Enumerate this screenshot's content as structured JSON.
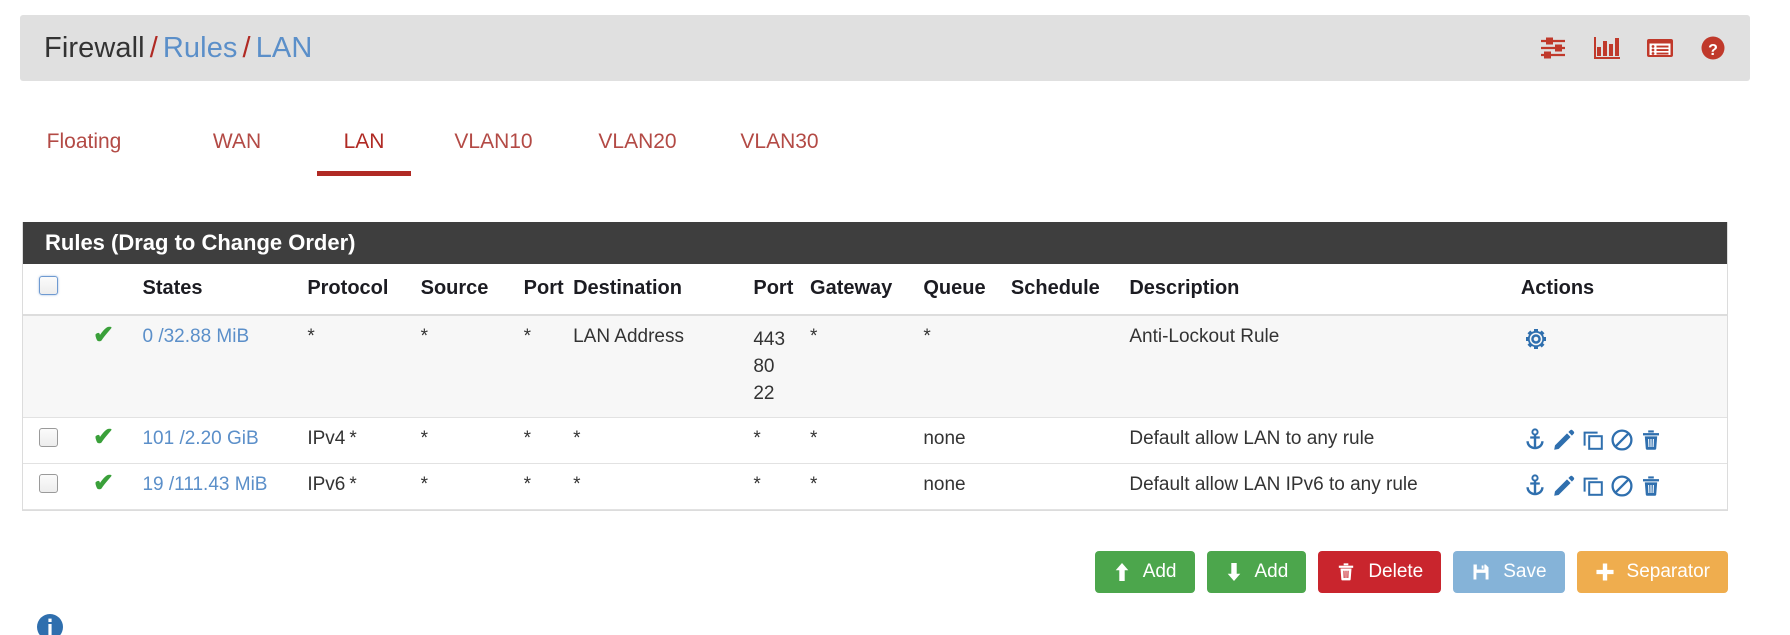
{
  "header": {
    "breadcrumb": {
      "root": "Firewall",
      "separator": "/",
      "links": [
        "Rules",
        "LAN"
      ]
    },
    "icons": [
      {
        "name": "sliders-icon",
        "label": "Advanced Filter"
      },
      {
        "name": "bar-chart-icon",
        "label": "Traffic Graph"
      },
      {
        "name": "table-list-icon",
        "label": "States Table"
      },
      {
        "name": "help-icon",
        "label": "Help"
      }
    ],
    "accent_color": "#b02a24",
    "link_color": "#5b8fc9",
    "bar_color": "#e0e0e0"
  },
  "tabs": {
    "items": [
      {
        "label": "Floating",
        "active": false
      },
      {
        "label": "WAN",
        "active": false
      },
      {
        "label": "LAN",
        "active": true
      },
      {
        "label": "VLAN10",
        "active": false
      },
      {
        "label": "VLAN20",
        "active": false
      },
      {
        "label": "VLAN30",
        "active": false
      }
    ]
  },
  "panel": {
    "title": "Rules (Drag to Change Order)",
    "title_bg": "#3e3e3e",
    "columns": [
      "",
      "",
      "States",
      "Protocol",
      "Source",
      "Port",
      "Destination",
      "Port",
      "Gateway",
      "Queue",
      "Schedule",
      "Description",
      "Actions"
    ],
    "rows": [
      {
        "checkbox": false,
        "has_checkbox": false,
        "status": "pass",
        "states": "0 /32.88 MiB",
        "protocol": "*",
        "protocol_version": "",
        "source": "*",
        "source_port": "*",
        "destination": "LAN Address",
        "dest_ports": [
          "443",
          "80",
          "22"
        ],
        "gateway": "*",
        "queue": "*",
        "schedule": "",
        "description": "Anti-Lockout Rule",
        "actions": [
          "gear-icon"
        ],
        "highlighted": true
      },
      {
        "checkbox": false,
        "has_checkbox": true,
        "status": "pass",
        "states": "101 /2.20 GiB",
        "protocol": "*",
        "protocol_version": "IPv4",
        "source": "*",
        "source_port": "*",
        "destination": "*",
        "dest_ports": [
          "*"
        ],
        "gateway": "*",
        "queue": "none",
        "schedule": "",
        "description": "Default allow LAN to any rule",
        "actions": [
          "anchor-icon",
          "edit-pencil-icon",
          "copy-icon",
          "disable-ban-icon",
          "delete-trash-icon"
        ],
        "highlighted": false
      },
      {
        "checkbox": false,
        "has_checkbox": true,
        "status": "pass",
        "states": "19 /111.43 MiB",
        "protocol": "*",
        "protocol_version": "IPv6",
        "source": "*",
        "source_port": "*",
        "destination": "*",
        "dest_ports": [
          "*"
        ],
        "gateway": "*",
        "queue": "none",
        "schedule": "",
        "description": "Default allow LAN IPv6 to any rule",
        "actions": [
          "anchor-icon",
          "edit-pencil-icon",
          "copy-icon",
          "disable-ban-icon",
          "delete-trash-icon"
        ],
        "highlighted": false
      }
    ]
  },
  "footer": {
    "buttons": [
      {
        "label": "Add",
        "icon": "arrow-up-icon",
        "color": "#4ca64c",
        "style": "btn-green"
      },
      {
        "label": "Add",
        "icon": "arrow-down-icon",
        "color": "#4ca64c",
        "style": "btn-green"
      },
      {
        "label": "Delete",
        "icon": "trash-icon",
        "color": "#c9252d",
        "style": "btn-red"
      },
      {
        "label": "Save",
        "icon": "floppy-save-icon",
        "color": "#85b3d8",
        "style": "btn-blue"
      },
      {
        "label": "Separator",
        "icon": "plus-icon",
        "color": "#efad4e",
        "style": "btn-orange"
      }
    ]
  },
  "legend": {
    "info_icon": "info-circle-icon"
  }
}
